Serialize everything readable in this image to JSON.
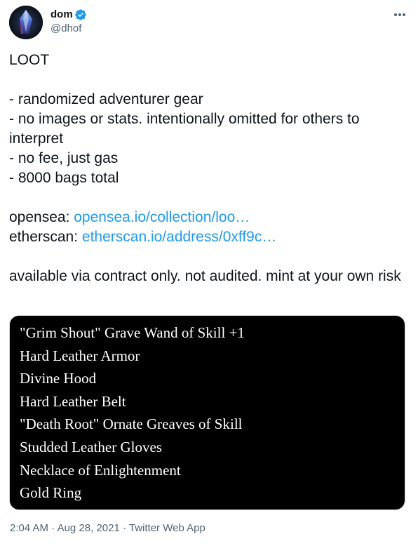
{
  "author": {
    "name": "dom",
    "handle": "@dhof",
    "verified": true
  },
  "tweet": {
    "lines": [
      "LOOT",
      "",
      "- randomized adventurer gear",
      "- no images or stats. intentionally omitted for others to interpret",
      "- no fee, just gas",
      "- 8000 bags total",
      ""
    ],
    "links": [
      {
        "label": "opensea: ",
        "url_text": "opensea.io/collection/loo…"
      },
      {
        "label": "etherscan: ",
        "url_text": "etherscan.io/address/0xff9c…"
      }
    ],
    "closing": "available via contract only. not audited. mint at your own risk"
  },
  "media": {
    "items": [
      "\"Grim Shout\" Grave Wand of Skill +1",
      "Hard Leather Armor",
      "Divine Hood",
      "Hard Leather Belt",
      "\"Death Root\" Ornate Greaves of Skill",
      "Studded Leather Gloves",
      "Necklace of Enlightenment",
      "Gold Ring"
    ]
  },
  "meta": {
    "time": "2:04 AM",
    "separator": " · ",
    "date": "Aug 28, 2021",
    "source": "Twitter Web App"
  },
  "colors": {
    "accent": "#1d9bf0",
    "text": "#0f1419",
    "muted": "#536471",
    "media_bg": "#000000"
  },
  "icons": {
    "verified": "verified-badge-icon",
    "more": "more-horizontal-icon"
  }
}
